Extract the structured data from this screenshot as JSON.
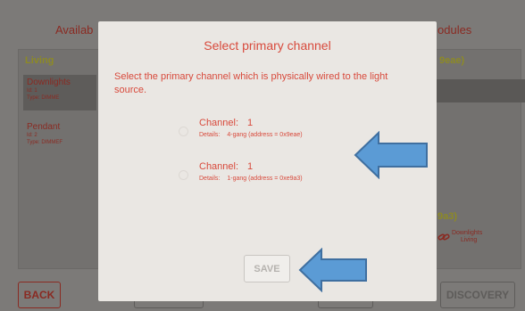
{
  "background": {
    "available_title": "Availab",
    "modules_title": "odules",
    "section_living": "Living",
    "right_code_top": "9eae)",
    "right_code_bottom": "9a3)",
    "items": [
      {
        "name": "Downlights",
        "id_label": "Id:",
        "id": "1",
        "type_label": "Type:",
        "type": "DIMME"
      },
      {
        "name": "Pendant",
        "id_label": "Id:",
        "id": "2",
        "type_label": "Type:",
        "type": "DIMMEF"
      }
    ],
    "fav_label": "Downlights",
    "fav_sub": "Living",
    "back_label": "BACK",
    "discovery_label": "DISCOVERY"
  },
  "modal": {
    "title": "Select primary channel",
    "description": "Select the primary channel which is physically wired to the light source.",
    "options": [
      {
        "channel_label": "Channel:",
        "channel": "1",
        "details_label": "Details:",
        "details": "4-gang (address = 0x9eae)"
      },
      {
        "channel_label": "Channel:",
        "channel": "1",
        "details_label": "Details:",
        "details": "1-gang (address = 0xe9a3)"
      }
    ],
    "save_label": "SAVE"
  },
  "colors": {
    "accent": "#d84a3c",
    "arrow_fill": "#5b9bd5",
    "arrow_stroke": "#3f6fa0",
    "modal_bg": "#eae7e3"
  },
  "icons": [
    "radio-icon",
    "link-icon",
    "right-arrow-icon",
    "left-arrow-icon"
  ]
}
